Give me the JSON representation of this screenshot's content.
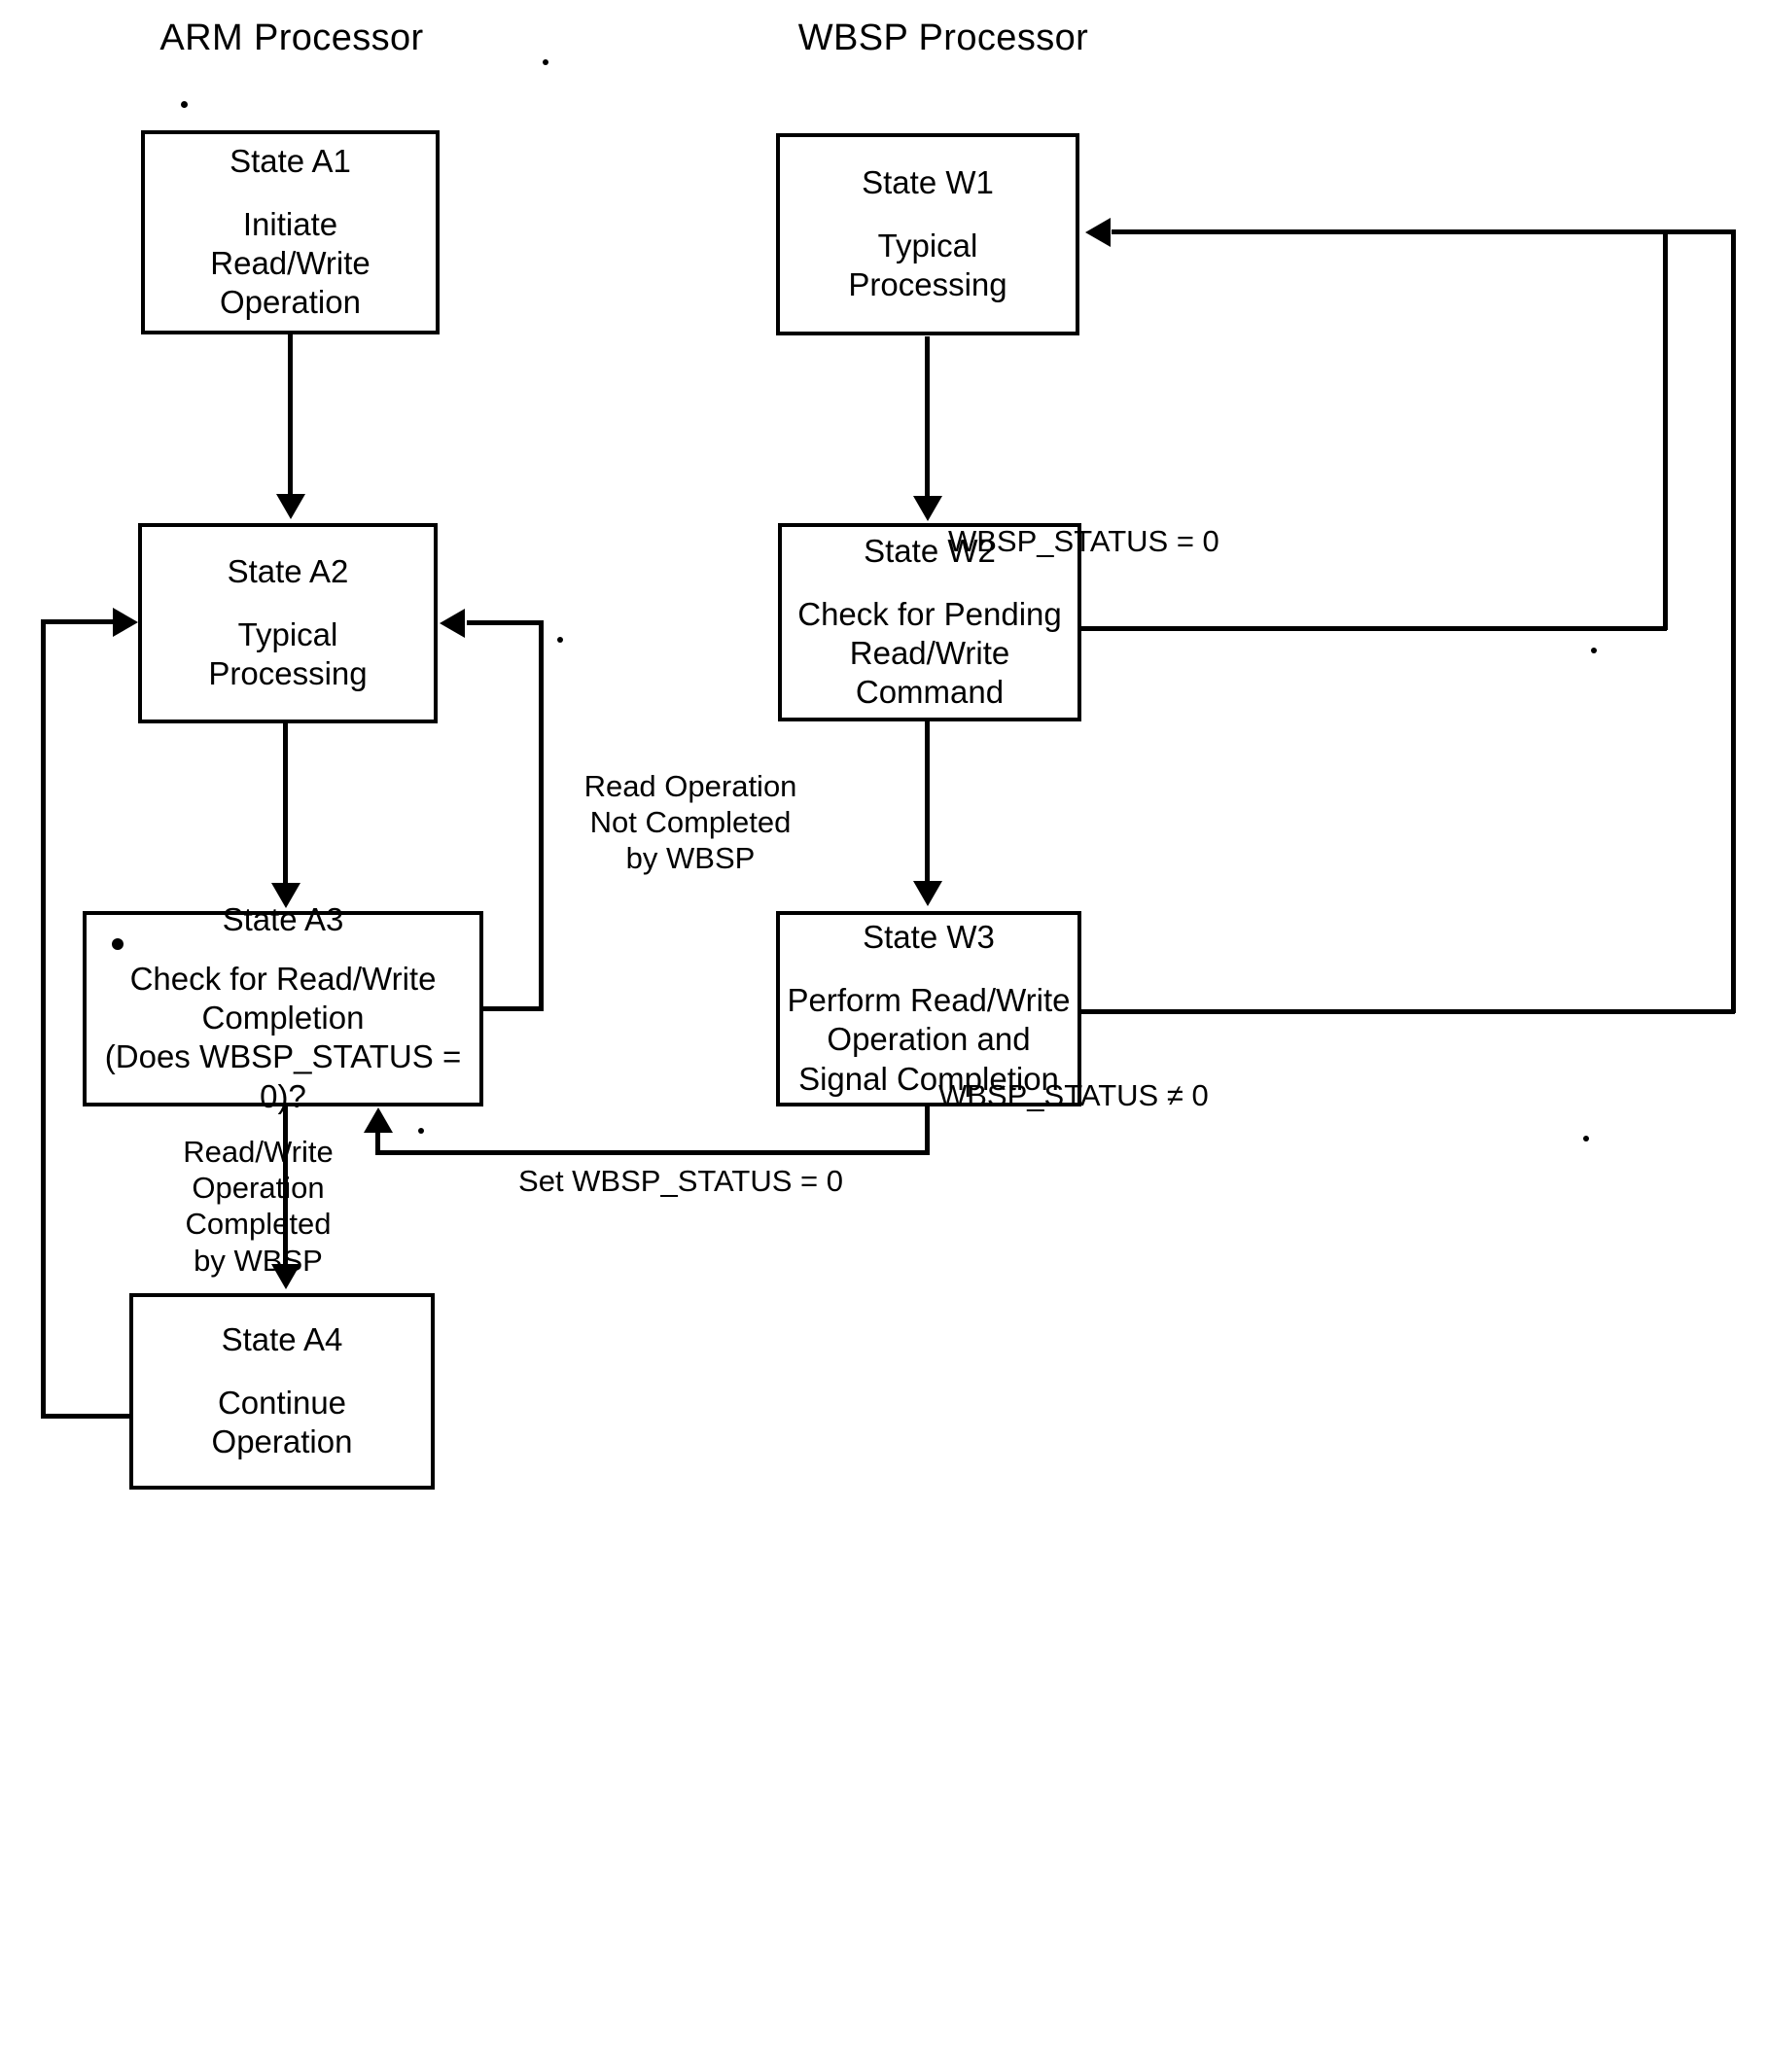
{
  "diagram": {
    "type": "flowchart",
    "columns": [
      {
        "id": "arm",
        "title": "ARM Processor"
      },
      {
        "id": "wbsp",
        "title": "WBSP Processor"
      }
    ],
    "nodes": [
      {
        "id": "A1",
        "column": "arm",
        "title": "State A1",
        "body": "Initiate\nRead/Write\nOperation"
      },
      {
        "id": "A2",
        "column": "arm",
        "title": "State A2",
        "body": "Typical\nProcessing"
      },
      {
        "id": "A3",
        "column": "arm",
        "title": "State A3",
        "body": "Check for Read/Write\nCompletion\n(Does WBSP_STATUS = 0)?"
      },
      {
        "id": "A4",
        "column": "arm",
        "title": "State A4",
        "body": "Continue\nOperation"
      },
      {
        "id": "W1",
        "column": "wbsp",
        "title": "State W1",
        "body": "Typical\nProcessing"
      },
      {
        "id": "W2",
        "column": "wbsp",
        "title": "State W2",
        "body": "Check for Pending\nRead/Write Command"
      },
      {
        "id": "W3",
        "column": "wbsp",
        "title": "State W3",
        "body": "Perform Read/Write\nOperation and\nSignal Completion"
      }
    ],
    "edge_labels": {
      "w1_to_w2": "WBSP_STATUS = 0",
      "w2_to_w3": "WBSP_STATUS ≠ 0",
      "a3_to_a2": "Read Operation\nNot Completed\nby WBSP",
      "a3_to_a4": "Read/Write\nOperation\nCompleted\nby WBSP",
      "w3_to_a3": "Set WBSP_STATUS = 0"
    },
    "edges": [
      {
        "from": "A1",
        "to": "A2",
        "label": ""
      },
      {
        "from": "A2",
        "to": "A3",
        "label": ""
      },
      {
        "from": "A3",
        "to": "A2",
        "label": "Read Operation\nNot Completed\nby WBSP"
      },
      {
        "from": "A3",
        "to": "A4",
        "label": "Read/Write\nOperation\nCompleted\nby WBSP"
      },
      {
        "from": "A4",
        "to": "A2",
        "label": ""
      },
      {
        "from": "W1",
        "to": "W2",
        "label": "WBSP_STATUS = 0"
      },
      {
        "from": "W2",
        "to": "W3",
        "label": "WBSP_STATUS ≠ 0"
      },
      {
        "from": "W2",
        "to": "W1",
        "label": ""
      },
      {
        "from": "W3",
        "to": "W1",
        "label": ""
      },
      {
        "from": "W3",
        "to": "A3",
        "label": "Set WBSP_STATUS = 0"
      }
    ],
    "colors": {
      "line": "#000000",
      "background": "#ffffff",
      "text": "#000000"
    }
  }
}
